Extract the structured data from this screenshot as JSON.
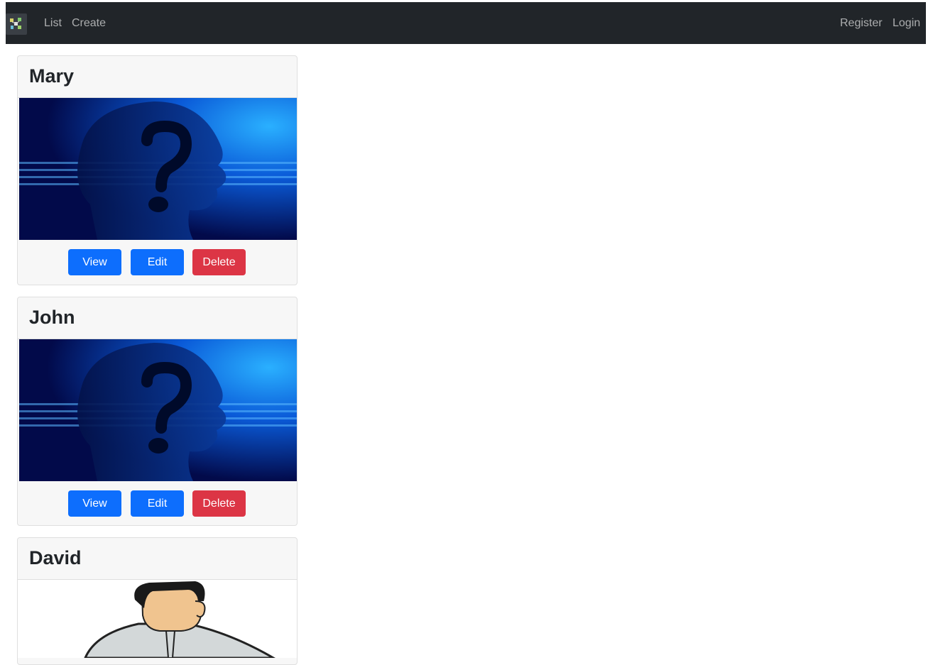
{
  "nav": {
    "brand_icon": "app-logo-icon",
    "left_links": [
      "List",
      "Create"
    ],
    "right_links": [
      "Register",
      "Login"
    ]
  },
  "cards": [
    {
      "name": "Mary",
      "image": "question-head-image",
      "actions": {
        "view": "View",
        "edit": "Edit",
        "delete": "Delete"
      }
    },
    {
      "name": "John",
      "image": "question-head-image",
      "actions": {
        "view": "View",
        "edit": "Edit",
        "delete": "Delete"
      }
    },
    {
      "name": "David",
      "image": "businessman-image"
    }
  ],
  "colors": {
    "navbar": "#212529",
    "primary": "#0d6efd",
    "danger": "#dc3545",
    "card_bg": "#f7f7f7"
  }
}
